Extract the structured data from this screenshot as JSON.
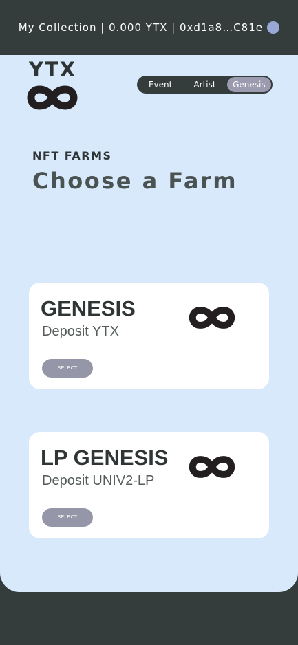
{
  "header": {
    "wallet_text": "My Collection | 0.000 YTX  | 0xd1a8…C81e"
  },
  "logo": {
    "name": "YTX",
    "icon": "infinity-icon"
  },
  "nav": {
    "options": [
      {
        "label": "Event",
        "active": false
      },
      {
        "label": "Artist",
        "active": false
      },
      {
        "label": "Genesis",
        "active": true
      }
    ]
  },
  "main": {
    "subheading": "NFT FARMS",
    "heading": "Choose a Farm"
  },
  "farms": [
    {
      "title": "GENESIS",
      "description": "Deposit YTX",
      "button": "SELECT",
      "icon": "infinity-icon"
    },
    {
      "title": "LP GENESIS",
      "description": "Deposit UNIV2-LP",
      "button": "SELECT",
      "icon": "infinity-icon"
    }
  ],
  "colors": {
    "dark": "#353c3c",
    "panel": "#d8e9fb",
    "accent": "#9b9aae",
    "avatar": "#98a9d8"
  }
}
